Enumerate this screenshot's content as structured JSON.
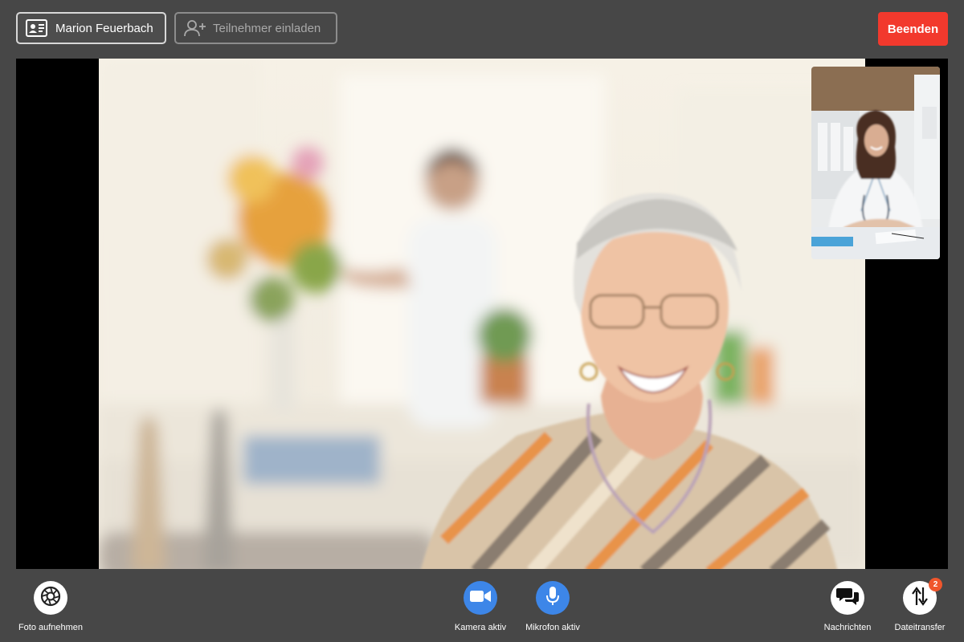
{
  "header": {
    "participant_name": "Marion Feuerbach",
    "invite_label": "Teilnehmer einladen",
    "end_label": "Beenden"
  },
  "colors": {
    "background": "#474747",
    "end_button": "#f2392d",
    "active_control": "#3d86e8",
    "badge": "#f0562c"
  },
  "controls": {
    "photo": {
      "label": "Foto aufnehmen",
      "icon": "camera-shutter-icon"
    },
    "camera": {
      "label": "Kamera aktiv",
      "icon": "video-camera-icon",
      "active": true
    },
    "microphone": {
      "label": "Mikrofon aktiv",
      "icon": "microphone-icon",
      "active": true
    },
    "messages": {
      "label": "Nachrichten",
      "icon": "chat-bubbles-icon"
    },
    "file_transfer": {
      "label": "Dateitransfer",
      "icon": "transfer-arrows-icon",
      "badge": "2"
    }
  }
}
